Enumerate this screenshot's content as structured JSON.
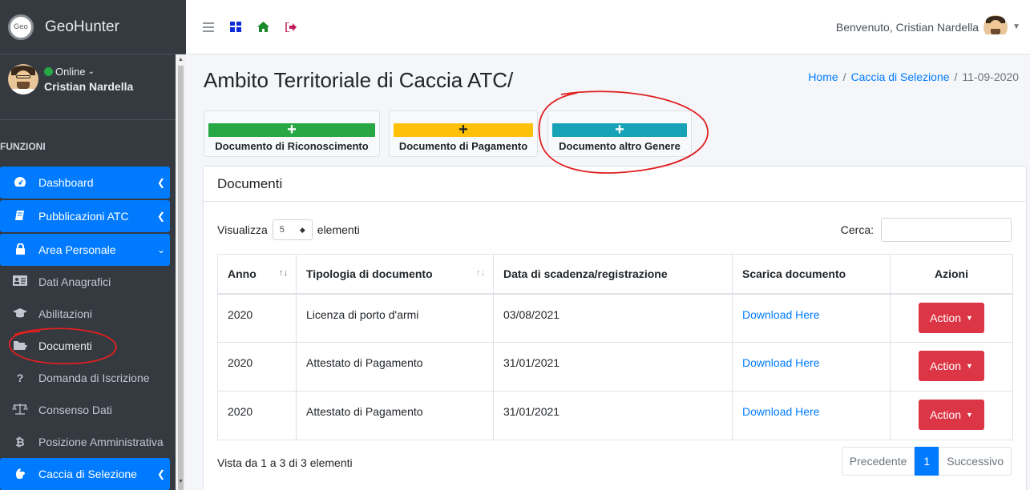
{
  "app": {
    "name": "GeoHunter",
    "logo_text": "Geo"
  },
  "user": {
    "status": "Online",
    "name": "Cristian Nardella",
    "greeting": "Benvenuto, Cristian Nardella"
  },
  "sidebar": {
    "section_header": "FUNZIONI",
    "items": [
      {
        "label": "Dashboard",
        "icon": "tachometer-icon",
        "active": true
      },
      {
        "label": "Pubblicazioni ATC",
        "icon": "book-icon",
        "active": true
      },
      {
        "label": "Area Personale",
        "icon": "lock-icon",
        "active": true
      },
      {
        "label": "Dati Anagrafici",
        "icon": "id-card-icon",
        "active": false
      },
      {
        "label": "Abilitazioni",
        "icon": "graduation-cap-icon",
        "active": false
      },
      {
        "label": "Documenti",
        "icon": "folder-open-icon",
        "active": false
      },
      {
        "label": "Domanda di Iscrizione",
        "icon": "question-icon",
        "active": false
      },
      {
        "label": "Consenso Dati",
        "icon": "balance-scale-icon",
        "active": false
      },
      {
        "label": "Posizione Amministrativa",
        "icon": "bitcoin-icon",
        "active": false
      },
      {
        "label": "Caccia di Selezione",
        "icon": "hand-icon",
        "active": true
      }
    ]
  },
  "topbar": {
    "icons": [
      "menu-icon",
      "grid-icon",
      "home-icon",
      "sign-out-icon"
    ]
  },
  "page": {
    "title": "Ambito Territoriale di Caccia ATC/",
    "breadcrumb": {
      "home": "Home",
      "section": "Caccia di Selezione",
      "current": "11-09-2020",
      "sep": "/"
    }
  },
  "doc_buttons": [
    {
      "label": "Documento di Riconoscimento",
      "color": "#28a745"
    },
    {
      "label": "Documento di Pagamento",
      "color": "#ffc107"
    },
    {
      "label": "Documento altro Genere",
      "color": "#17a2b8"
    }
  ],
  "card": {
    "title": "Documenti",
    "length": {
      "prefix": "Visualizza",
      "value": "5",
      "suffix": "elementi"
    },
    "search_label": "Cerca:",
    "columns": [
      "Anno",
      "Tipologia di documento",
      "Data di scadenza/registrazione",
      "Scarica documento",
      "Azioni"
    ],
    "rows": [
      {
        "anno": "2020",
        "tipo": "Licenza di porto d'armi",
        "data": "03/08/2021",
        "link": "Download Here",
        "action": "Action"
      },
      {
        "anno": "2020",
        "tipo": "Attestato di Pagamento",
        "data": "31/01/2021",
        "link": "Download Here",
        "action": "Action"
      },
      {
        "anno": "2020",
        "tipo": "Attestato di Pagamento",
        "data": "31/01/2021",
        "link": "Download Here",
        "action": "Action"
      }
    ],
    "info": "Vista da 1 a 3 di 3 elementi",
    "pager": {
      "prev": "Precedente",
      "page": "1",
      "next": "Successivo"
    }
  },
  "colors": {
    "sidebar_bg": "#343a40",
    "active": "#007bff",
    "danger": "#dc3545",
    "annotation": "#e02020"
  }
}
